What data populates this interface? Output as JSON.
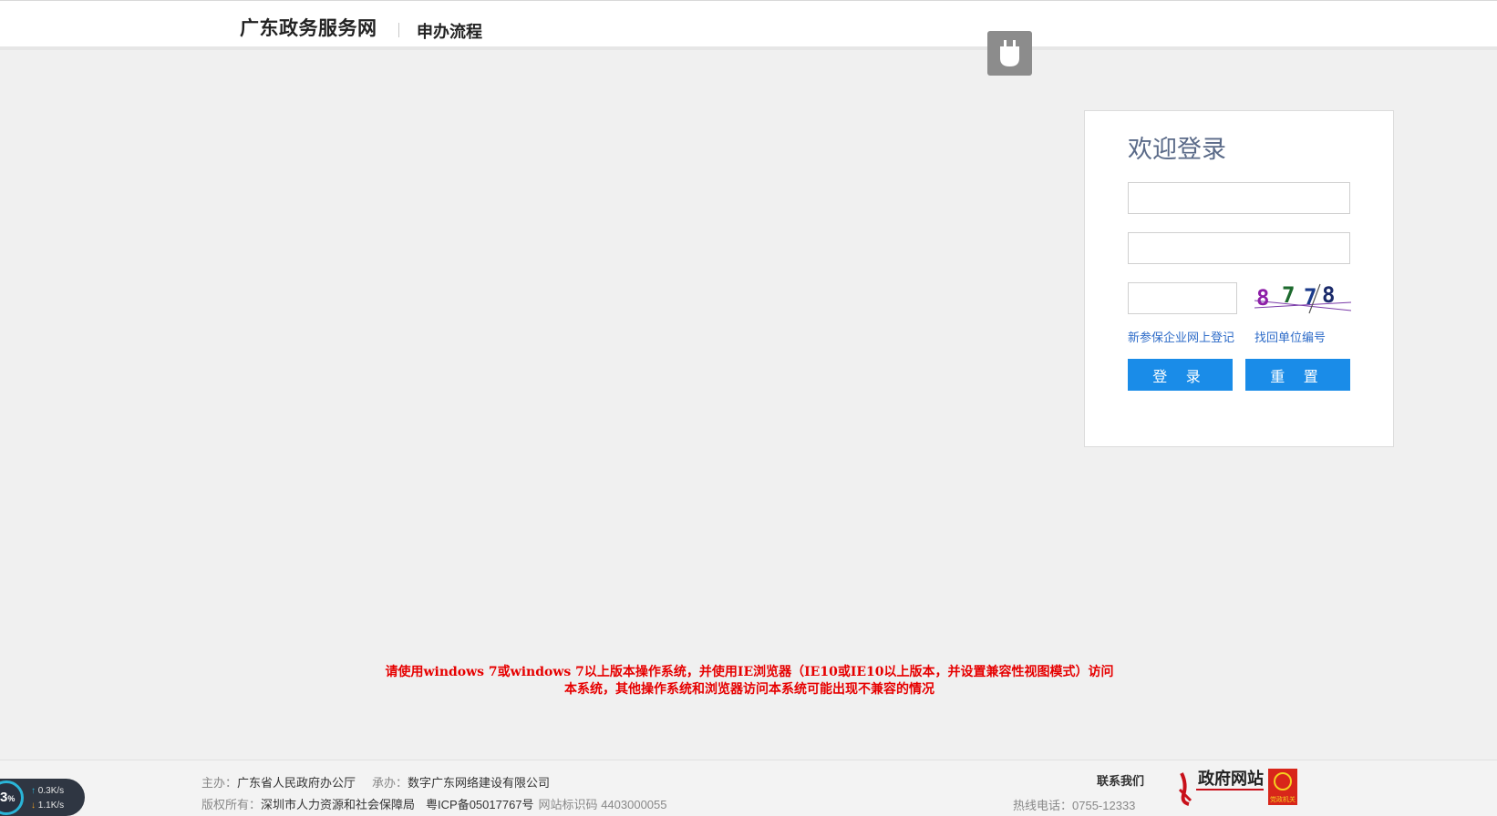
{
  "header": {
    "site_title": "广东政务服务网",
    "nav_item": "申办流程"
  },
  "login": {
    "title": "欢迎登录",
    "username_value": "",
    "password_value": "",
    "captcha_value": "",
    "captcha_text": "8778",
    "register_link": "新参保企业网上登记",
    "recover_link": "找回单位编号",
    "login_button": "登 录",
    "reset_button": "重 置"
  },
  "notice": {
    "line1": "请使用windows 7或windows 7以上版本操作系统，并使用IE浏览器（IE10或IE10以上版本，并设置兼容性视图模式）访问",
    "line2": "本系统，其他操作系统和浏览器访问本系统可能出现不兼容的情况"
  },
  "footer": {
    "host_label": "主办：",
    "host_value": "广东省人民政府办公厅",
    "undertake_label": "承办：",
    "undertake_value": "数字广东网络建设有限公司",
    "copyright_label": "版权所有：",
    "copyright_value": "深圳市人力资源和社会保障局",
    "icp": "粤ICP备05017767号",
    "site_id_label": "网站标识码",
    "site_id_value": "4403000055",
    "contact_title": "联系我们",
    "hotline": "热线电话：0755-12333",
    "gov_logo_text": "政府网站",
    "party_logo_text": "党政机关"
  },
  "speed_widget": {
    "percent": "3",
    "percent_unit": "%",
    "upload": "0.3",
    "download": "1.1",
    "unit": "K/s"
  },
  "colors": {
    "accent_button": "#1a8ce8",
    "notice_red": "#e60000",
    "link_blue": "#2d6bc8",
    "title_gray_blue": "#5a6a88"
  }
}
